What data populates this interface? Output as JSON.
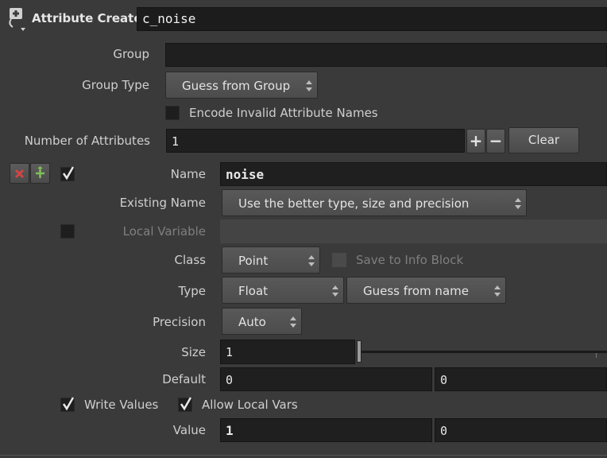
{
  "header": {
    "node_type": "Attribute Create",
    "node_name": "c_noise"
  },
  "group": {
    "label": "Group",
    "value": ""
  },
  "group_type": {
    "label": "Group Type",
    "value": "Guess from Group"
  },
  "encode_invalid": {
    "label": "Encode Invalid Attribute Names",
    "checked": false
  },
  "num_attributes": {
    "label": "Number of Attributes",
    "value": "1",
    "plus": "+",
    "minus": "−",
    "clear": "Clear"
  },
  "attr": {
    "enabled": true,
    "name_label": "Name",
    "name_value": "noise",
    "existing_name_label": "Existing Name",
    "existing_name_value": "Use the better type, size and precision",
    "local_variable_label": "Local Variable",
    "local_variable_value": "",
    "class_label": "Class",
    "class_value": "Point",
    "save_info_label": "Save to Info Block",
    "type_label": "Type",
    "type_value": "Float",
    "type_info": "Guess from name",
    "precision_label": "Precision",
    "precision_value": "Auto",
    "size_label": "Size",
    "size_value": "1",
    "size_slider_fraction": 0,
    "default_label": "Default",
    "default_values": [
      "0",
      "0"
    ],
    "write_values_label": "Write Values",
    "write_values": true,
    "allow_local_vars_label": "Allow Local Vars",
    "allow_local_vars": true,
    "value_label": "Value",
    "value_values": [
      "1",
      "0"
    ]
  }
}
